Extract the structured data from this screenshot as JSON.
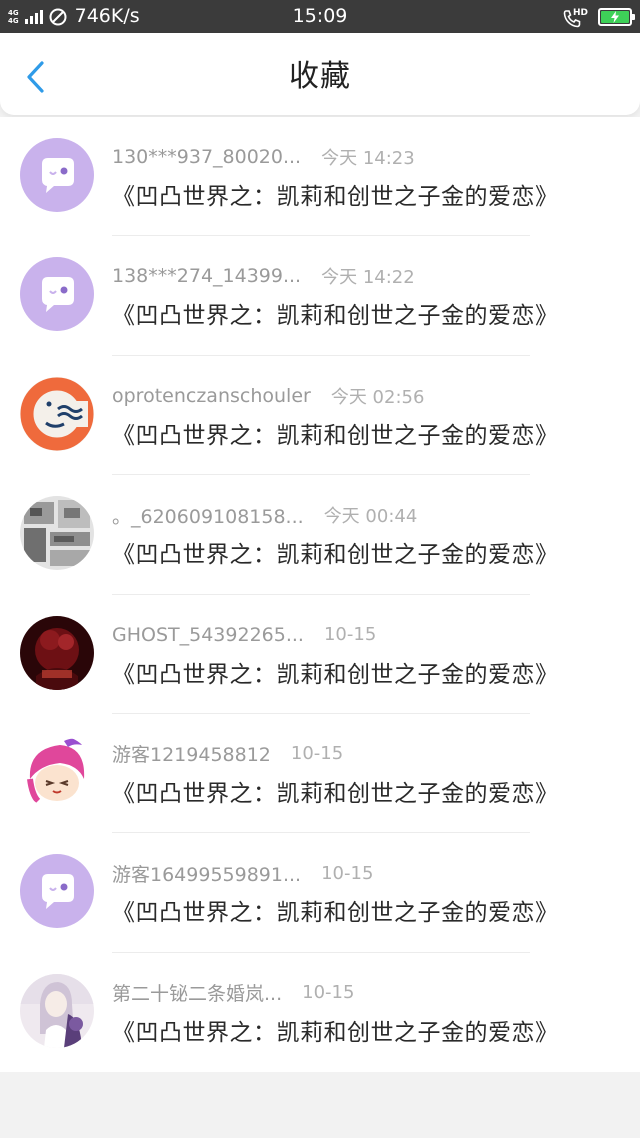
{
  "status_bar": {
    "network_tags": [
      "4G",
      "4G"
    ],
    "speed": "746K/s",
    "time": "15:09",
    "hd_label": "HD"
  },
  "header": {
    "title": "收藏"
  },
  "favorites": [
    {
      "username": "130***937_80020...",
      "time": "今天 14:23",
      "title": "《凹凸世界之：凯莉和创世之子金的爱恋》",
      "avatar": "default-bubble"
    },
    {
      "username": "138***274_14399...",
      "time": "今天 14:22",
      "title": "《凹凸世界之：凯莉和创世之子金的爱恋》",
      "avatar": "default-bubble"
    },
    {
      "username": "oprotenczanschouler",
      "time": "今天 02:56",
      "title": "《凹凸世界之：凯莉和创世之子金的爱恋》",
      "avatar": "orange-wave-logo"
    },
    {
      "username": "。_620609108158...",
      "time": "今天 00:44",
      "title": "《凹凸世界之：凯莉和创世之子金的爱恋》",
      "avatar": "manga-collage"
    },
    {
      "username": "GHOST_54392265...",
      "time": "10-15",
      "title": "《凹凸世界之：凯莉和创世之子金的爱恋》",
      "avatar": "dark-red-character"
    },
    {
      "username": "游客1219458812",
      "time": "10-15",
      "title": "《凹凸世界之：凯莉和创世之子金的爱恋》",
      "avatar": "pink-hair-character"
    },
    {
      "username": "游客16499559891...",
      "time": "10-15",
      "title": "《凹凸世界之：凯莉和创世之子金的爱恋》",
      "avatar": "default-bubble"
    },
    {
      "username": "第二十铋二条婚岚...",
      "time": "10-15",
      "title": "《凹凸世界之：凯莉和创世之子金的爱恋》",
      "avatar": "anime-girl-portrait"
    }
  ],
  "colors": {
    "accent": "#2f9be8",
    "default_avatar_bg": "#c9b2ec",
    "status_bar_bg": "#3b3b3b",
    "battery": "#3ed158"
  }
}
